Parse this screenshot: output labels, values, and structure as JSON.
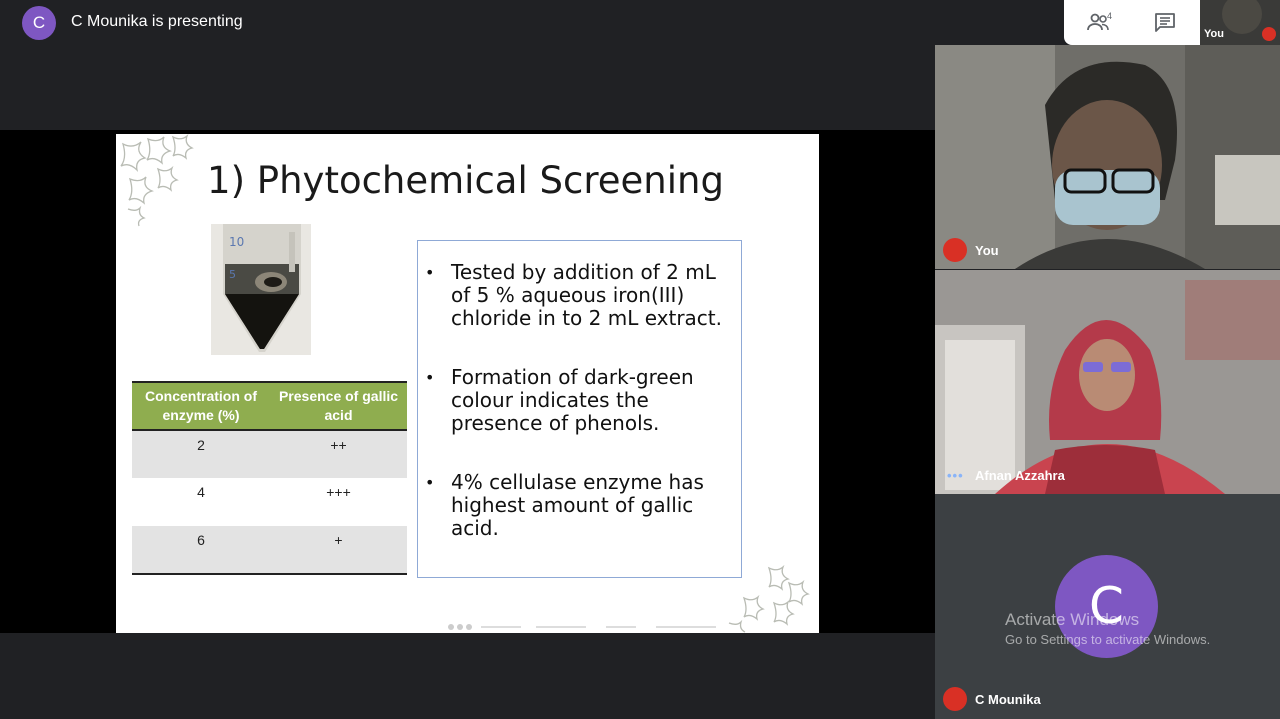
{
  "presenter": {
    "avatar_letter": "C",
    "banner_text": "C Mounika is presenting"
  },
  "top_controls": {
    "participant_count": "4",
    "people_icon": "people-icon",
    "chat_icon": "chat-icon"
  },
  "self_thumbnail": {
    "label": "You"
  },
  "slide": {
    "title": "1) Phytochemical Screening",
    "table": {
      "headers": [
        "Concentration of enzyme (%)",
        "Presence of gallic acid"
      ],
      "rows": [
        [
          "2",
          "++"
        ],
        [
          "4",
          "+++"
        ],
        [
          "6",
          "+"
        ]
      ]
    },
    "bullets": [
      "Tested by  addition of 2 mL of 5 % aqueous iron(III) chloride in to 2 mL extract.",
      "Formation of dark-green colour indicates the presence of phenols.",
      "4% cellulase enzyme has highest amount of gallic acid."
    ]
  },
  "participants": [
    {
      "name": "You",
      "muted": true
    },
    {
      "name": "Afnan Azzahra",
      "speaking": true
    },
    {
      "name": "C Mounika",
      "muted": true,
      "avatar_letter": "C"
    }
  ],
  "watermark": {
    "line1": "Activate Windows",
    "line2": "Go to Settings to activate Windows."
  },
  "colors": {
    "avatar_purple": "#7e57c2",
    "table_header_green": "#8fad4f",
    "muted_red": "#d93025"
  }
}
